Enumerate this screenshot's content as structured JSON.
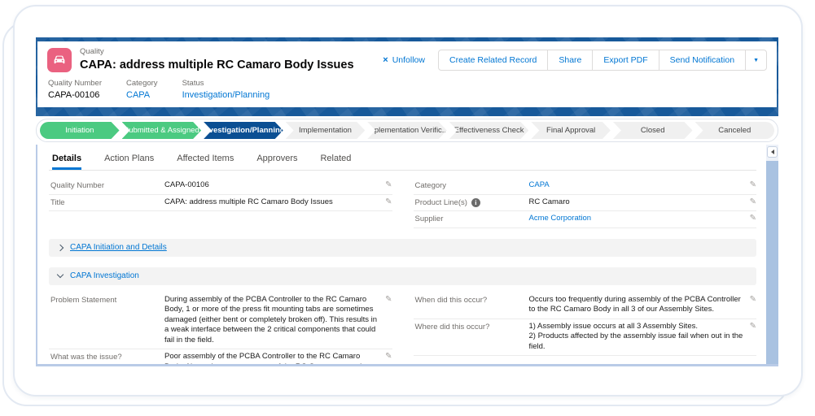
{
  "colors": {
    "brand_blue": "#0176d3",
    "banner_blue": "#17599a",
    "stage_complete_green": "#4bca81",
    "stage_current_navy": "#0b4f93",
    "record_icon_pink": "#ea6180",
    "scrollbar_blue": "#a9c2e1"
  },
  "icons": {
    "close": "×",
    "dropdown": "▼",
    "pencil": "✎",
    "info": "i"
  },
  "header": {
    "object_label": "Quality",
    "record_title": "CAPA: address multiple RC Camaro Body Issues",
    "actions": {
      "unfollow_label": "Unfollow",
      "buttons": [
        "Create Related Record",
        "Share",
        "Export PDF",
        "Send Notification"
      ]
    },
    "summary_fields": [
      {
        "label": "Quality Number",
        "value": "CAPA-00106"
      },
      {
        "label": "Category",
        "value": "CAPA"
      },
      {
        "label": "Status",
        "value": "Investigation/Planning"
      }
    ]
  },
  "path": {
    "stages": [
      {
        "label": "Initiation",
        "state": "complete"
      },
      {
        "label": "Submitted & Assigned",
        "state": "complete"
      },
      {
        "label": "Investigation/Planning",
        "state": "current"
      },
      {
        "label": "Implementation",
        "state": "incomplete"
      },
      {
        "label": "Implementation Verific...",
        "state": "incomplete"
      },
      {
        "label": "Effectiveness Check",
        "state": "incomplete"
      },
      {
        "label": "Final Approval",
        "state": "incomplete"
      },
      {
        "label": "Closed",
        "state": "incomplete"
      },
      {
        "label": "Canceled",
        "state": "incomplete"
      }
    ]
  },
  "tabs": [
    {
      "label": "Details",
      "active": true
    },
    {
      "label": "Action Plans",
      "active": false
    },
    {
      "label": "Affected Items",
      "active": false
    },
    {
      "label": "Approvers",
      "active": false
    },
    {
      "label": "Related",
      "active": false
    }
  ],
  "details": {
    "left_fields": [
      {
        "label": "Quality Number",
        "value": "CAPA-00106"
      },
      {
        "label": "Title",
        "value": "CAPA: address multiple RC Camaro Body Issues"
      }
    ],
    "right_fields": [
      {
        "label": "Category",
        "value": "CAPA",
        "link": true
      },
      {
        "label": "Product Line(s)",
        "value": "RC Camaro",
        "help": true
      },
      {
        "label": "Supplier",
        "value": "Acme Corporation",
        "link": true
      }
    ],
    "sections": [
      {
        "title": "CAPA Initiation and Details",
        "expanded": false
      },
      {
        "title": "CAPA Investigation",
        "expanded": true
      }
    ],
    "investigation_left": [
      {
        "label": "Problem Statement",
        "value": "During assembly of the PCBA Controller to the RC Camaro Body, 1 or more of the press fit mounting tabs are sometimes damaged (either bent or completely broken off). This results in a weak interface between the 2 critical components that could fail in the field."
      },
      {
        "label": "What was the issue?",
        "value": "Poor assembly of the PCBA Controller to the RC Camaro Body. Also, a larger percentage of the RC Camaro parts that are being damage during the assembly process are from our Primary Vendor (Acme Corporation)."
      }
    ],
    "investigation_right": [
      {
        "label": "When did this occur?",
        "value": "Occurs too frequently during assembly of the PCBA Controller to the RC Camaro Body in all 3 of our Assembly Sites."
      },
      {
        "label": "Where did this occur?",
        "value": "1) Assembly issue occurs at all 3 Assembly Sites.\n2) Products affected by the assembly issue fail when out in the field."
      }
    ]
  }
}
